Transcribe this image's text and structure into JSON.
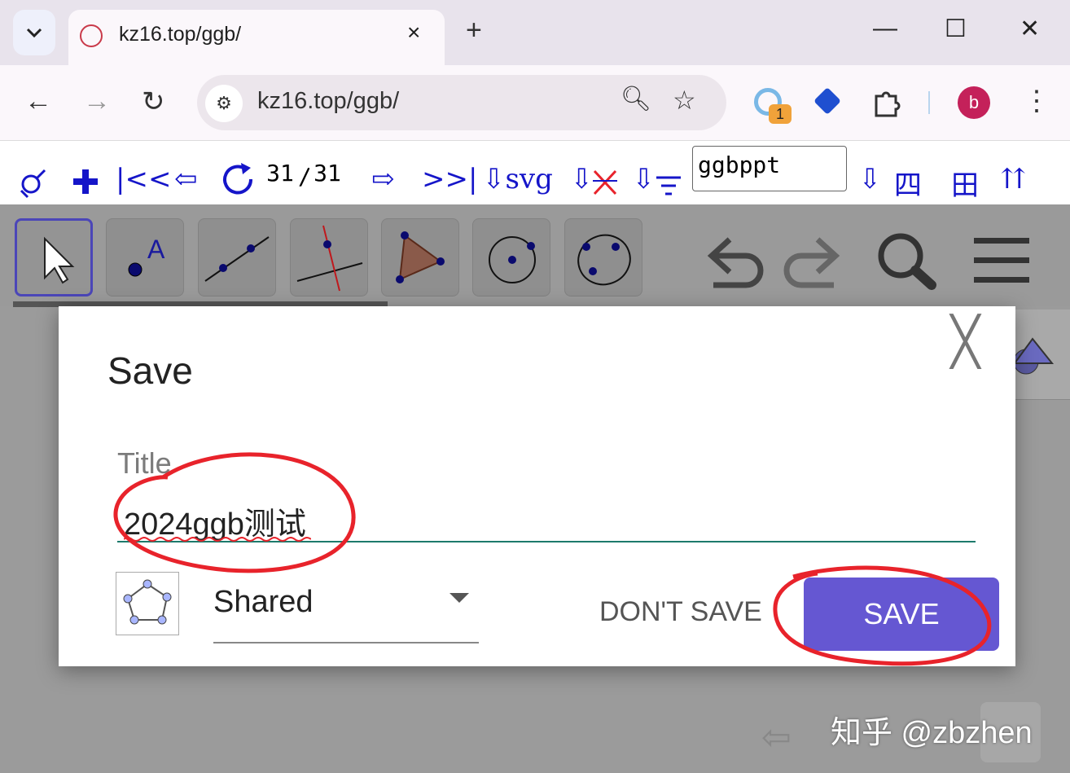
{
  "browser": {
    "tab_title": "kz16.top/ggb/",
    "tab_close": "×",
    "new_tab": "+",
    "url": "kz16.top/ggb/",
    "extension_badge": "1",
    "profile_initial": "b",
    "window_controls": {
      "minimize": "—",
      "maximize": "☐",
      "close": "✕"
    },
    "nav": {
      "back": "←",
      "forward": "→",
      "reload": "↻"
    },
    "menu_icon": "⋮"
  },
  "ggb_toolbar": {
    "first": "|<<",
    "prev": "⇦",
    "current": "31",
    "separator": "/",
    "total": "31",
    "next": "⇨",
    "last": ">>|",
    "export_svg": "⇩svg",
    "download": "⇩",
    "input_value": "ggbppt",
    "quad": "四",
    "grid": "田",
    "top": "⇈"
  },
  "dialog": {
    "title": "Save",
    "close": "╳",
    "title_label": "Title",
    "title_value": "2024ggb测试",
    "visibility": "Shared",
    "dont_save": "DON'T SAVE",
    "save": "SAVE"
  },
  "watermark": "知乎 @zbzhen",
  "colors": {
    "accent": "#6557d2",
    "underline": "#1d7a6b",
    "ggb_blue": "#1515c9",
    "annotation_red": "#e8232b"
  }
}
